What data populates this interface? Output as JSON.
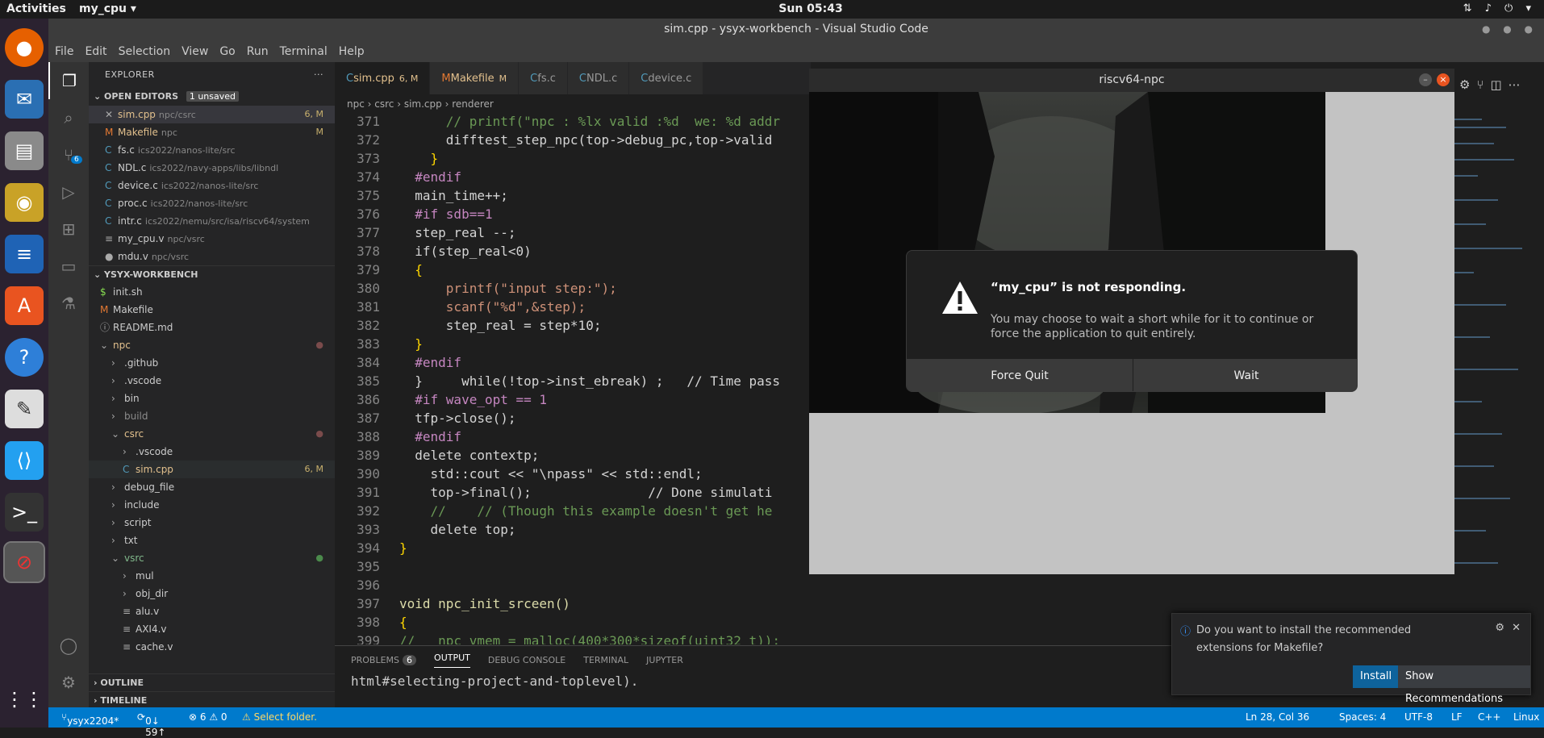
{
  "topbar": {
    "activities": "Activities",
    "app": "my_cpu ▾",
    "clock": "Sun 05:43"
  },
  "window": {
    "title": "sim.cpp - ysyx-workbench - Visual Studio Code"
  },
  "menu": [
    "File",
    "Edit",
    "Selection",
    "View",
    "Go",
    "Run",
    "Terminal",
    "Help"
  ],
  "activity": {
    "scm_badge": "6"
  },
  "explorer": {
    "header": "EXPLORER",
    "open_editors": "OPEN EDITORS",
    "unsaved": "1 unsaved",
    "open": [
      {
        "name": "sim.cpp",
        "dir": "npc/csrc",
        "status": "6, M",
        "prefix": "✕"
      },
      {
        "name": "Makefile",
        "dir": "npc",
        "status": "M",
        "prefix": "M"
      },
      {
        "name": "fs.c",
        "dir": "ics2022/nanos-lite/src",
        "status": "",
        "prefix": "C"
      },
      {
        "name": "NDL.c",
        "dir": "ics2022/navy-apps/libs/libndl",
        "status": "",
        "prefix": "C"
      },
      {
        "name": "device.c",
        "dir": "ics2022/nanos-lite/src",
        "status": "",
        "prefix": "C"
      },
      {
        "name": "proc.c",
        "dir": "ics2022/nanos-lite/src",
        "status": "",
        "prefix": "C"
      },
      {
        "name": "intr.c",
        "dir": "ics2022/nemu/src/isa/riscv64/system",
        "status": "",
        "prefix": "C"
      },
      {
        "name": "my_cpu.v",
        "dir": "npc/vsrc",
        "status": "",
        "prefix": "≡"
      },
      {
        "name": "mdu.v",
        "dir": "npc/vsrc",
        "status": "",
        "prefix": "●"
      }
    ],
    "workspace": "YSYX-WORKBENCH",
    "tree": [
      {
        "name": "init.sh",
        "indent": 1,
        "prefix": "$"
      },
      {
        "name": "Makefile",
        "indent": 1,
        "prefix": "M"
      },
      {
        "name": "README.md",
        "indent": 1,
        "prefix": "ⓘ"
      },
      {
        "name": "npc",
        "indent": 1,
        "prefix": "⌄",
        "mod": true
      },
      {
        "name": ".github",
        "indent": 2,
        "prefix": "›"
      },
      {
        "name": ".vscode",
        "indent": 2,
        "prefix": "›"
      },
      {
        "name": "bin",
        "indent": 2,
        "prefix": "›"
      },
      {
        "name": "build",
        "indent": 2,
        "prefix": "›"
      },
      {
        "name": "csrc",
        "indent": 2,
        "prefix": "⌄",
        "mod": true
      },
      {
        "name": ".vscode",
        "indent": 3,
        "prefix": "›"
      },
      {
        "name": "sim.cpp",
        "indent": 3,
        "prefix": "C",
        "status": "6, M"
      },
      {
        "name": "debug_file",
        "indent": 2,
        "prefix": "›"
      },
      {
        "name": "include",
        "indent": 2,
        "prefix": "›"
      },
      {
        "name": "script",
        "indent": 2,
        "prefix": "›"
      },
      {
        "name": "txt",
        "indent": 2,
        "prefix": "›"
      },
      {
        "name": "vsrc",
        "indent": 2,
        "prefix": "⌄",
        "green": true
      },
      {
        "name": "mul",
        "indent": 3,
        "prefix": "›"
      },
      {
        "name": "obj_dir",
        "indent": 3,
        "prefix": "›"
      },
      {
        "name": "alu.v",
        "indent": 3,
        "prefix": "≡"
      },
      {
        "name": "AXI4.v",
        "indent": 3,
        "prefix": "≡"
      },
      {
        "name": "cache.v",
        "indent": 3,
        "prefix": "≡"
      }
    ],
    "outline": "OUTLINE",
    "timeline": "TIMELINE"
  },
  "tabs": [
    {
      "label": "sim.cpp",
      "status": "6, M",
      "active": true
    },
    {
      "label": "Makefile",
      "status": "M"
    },
    {
      "label": "fs.c",
      "status": ""
    },
    {
      "label": "NDL.c",
      "status": ""
    },
    {
      "label": "device.c",
      "status": ""
    }
  ],
  "breadcrumb": [
    "npc",
    "csrc",
    "sim.cpp",
    "renderer"
  ],
  "code": [
    {
      "n": "371",
      "t": "      // printf(\"npc : %lx valid :%d  we: %d addr"
    },
    {
      "n": "372",
      "t": "      difftest_step_npc(top->debug_pc,top->valid"
    },
    {
      "n": "373",
      "t": "    }"
    },
    {
      "n": "374",
      "t": "  #endif"
    },
    {
      "n": "375",
      "t": "  main_time++;"
    },
    {
      "n": "376",
      "t": "  #if sdb==1"
    },
    {
      "n": "377",
      "t": "  step_real --;"
    },
    {
      "n": "378",
      "t": "  if(step_real<0)"
    },
    {
      "n": "379",
      "t": "  {"
    },
    {
      "n": "380",
      "t": "      printf(\"input step:\");"
    },
    {
      "n": "381",
      "t": "      scanf(\"%d\",&step);"
    },
    {
      "n": "382",
      "t": "      step_real = step*10;"
    },
    {
      "n": "383",
      "t": "  }"
    },
    {
      "n": "384",
      "t": "  #endif"
    },
    {
      "n": "385",
      "t": "  }     while(!top->inst_ebreak) ;   // Time pass"
    },
    {
      "n": "386",
      "t": "  #if wave_opt == 1"
    },
    {
      "n": "387",
      "t": "  tfp->close();"
    },
    {
      "n": "388",
      "t": "  #endif"
    },
    {
      "n": "389",
      "t": "  delete contextp;"
    },
    {
      "n": "390",
      "t": "    std::cout << \"\\npass\" << std::endl;"
    },
    {
      "n": "391",
      "t": "    top->final();               // Done simulati"
    },
    {
      "n": "392",
      "t": "    //    // (Though this example doesn't get he"
    },
    {
      "n": "393",
      "t": "    delete top;"
    },
    {
      "n": "394",
      "t": "}"
    },
    {
      "n": "395",
      "t": ""
    },
    {
      "n": "396",
      "t": ""
    },
    {
      "n": "397",
      "t": "void npc_init_srceen()"
    },
    {
      "n": "398",
      "t": "{"
    },
    {
      "n": "399",
      "t": "//   npc_vmem = malloc(400*300*sizeof(uint32_t));"
    }
  ],
  "panel": {
    "tabs": [
      "PROBLEMS",
      "OUTPUT",
      "DEBUG CONSOLE",
      "TERMINAL",
      "JUPYTER"
    ],
    "problems_count": "6",
    "output_text": "html#selecting-project-and-toplevel)."
  },
  "status": {
    "branch": "ysyx2204*",
    "sync": "0↓ 59↑",
    "problems": "⊗ 6 ⚠ 0",
    "folder": "⚠ Select folder.",
    "pos": "Ln 28, Col 36",
    "spaces": "Spaces: 4",
    "enc": "UTF-8",
    "eol": "LF",
    "lang": "C++",
    "os": "Linux"
  },
  "riscv": {
    "title": "riscv64-npc"
  },
  "dialog": {
    "title": "“my_cpu” is not responding.",
    "message": "You may choose to wait a short while for it to continue or force the application to quit entirely.",
    "force": "Force Quit",
    "wait": "Wait"
  },
  "notification": {
    "text": "Do you want to install the recommended extensions for Makefile?",
    "install": "Install",
    "show": "Show Recommendations"
  },
  "colors": {
    "accent": "#007acc",
    "ubuntu_orange": "#e95420"
  }
}
